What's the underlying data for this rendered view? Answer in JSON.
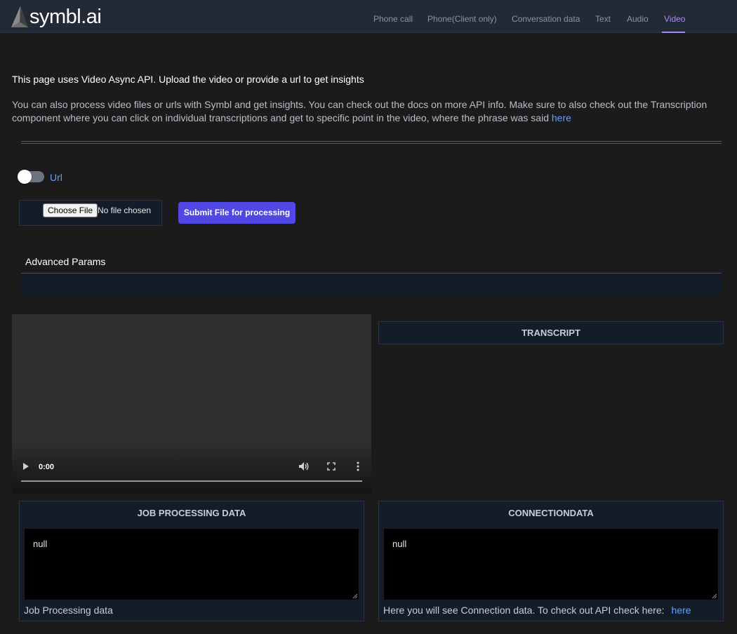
{
  "brand": {
    "name": "symbl.ai",
    "logo_icon": "symbl-logo-icon"
  },
  "nav": {
    "items": [
      {
        "label": "Phone call"
      },
      {
        "label": "Phone(Client only)"
      },
      {
        "label": "Conversation data"
      },
      {
        "label": "Text"
      },
      {
        "label": "Audio"
      },
      {
        "label": "Video",
        "active": true
      }
    ]
  },
  "intro": "This page uses Video Async API. Upload the video or provide a url to get insights",
  "description": {
    "text": "You can also process video files or urls with Symbl and get insights. You can check out the docs on more API info. Make sure to also check out the Transcription component where you can click on individual transcriptions and get to specific point in the video, where the phrase was said ",
    "link_text": "here"
  },
  "toggle": {
    "label": "Url",
    "checked": false
  },
  "file_input": {
    "button_label": "Choose File",
    "status": "No file chosen"
  },
  "submit_button": "Submit File for processing",
  "advanced_params": {
    "label": "Advanced Params"
  },
  "video_player": {
    "time": "0:00",
    "progress": 0
  },
  "transcript": {
    "title": "TRANSCRIPT"
  },
  "job_panel": {
    "title": "JOB PROCESSING DATA",
    "value": "null",
    "footer": "Job Processing data"
  },
  "connection_panel": {
    "title": "CONNECTIONDATA",
    "value": "null",
    "footer": "Here you will see Connection data. To check out API check here:",
    "link_text": "here"
  },
  "colors": {
    "accent": "#5147e5",
    "nav_active": "#a78bfa",
    "link": "#5ea1ff",
    "panel_bg": "#141c2a",
    "page_bg": "#1b1b1b"
  }
}
